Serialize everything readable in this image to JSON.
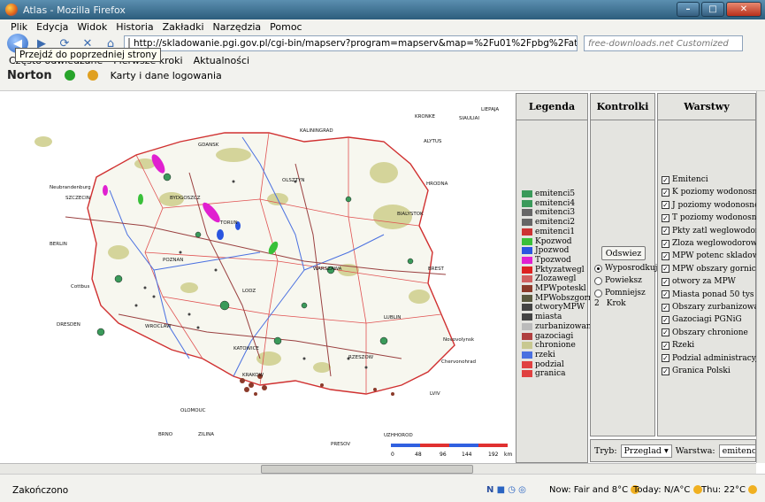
{
  "window": {
    "title": "Atlas - Mozilla Firefox"
  },
  "menu": [
    "Plik",
    "Edycja",
    "Widok",
    "Historia",
    "Zakładki",
    "Narzędzia",
    "Pomoc"
  ],
  "nav": {
    "url": "http://skladowanie.pgi.gov.pl/cgi-bin/mapserv?program=mapserv&map=%2Fu01%2Fpbg%2Fatlas.map",
    "search_placeholder": "free-downloads.net Customized",
    "tooltip": "Przejdź do poprzedniej strony"
  },
  "bookmarks": [
    "Często odwiedzane",
    "Pierwsze kroki",
    "Aktualności"
  ],
  "norton": {
    "label": "Norton",
    "cards": "Karty i dane logowania"
  },
  "panels": {
    "legend": "Legenda",
    "controls": "Kontrolki",
    "layers": "Warstwy"
  },
  "legend": [
    {
      "label": "emitenci5",
      "color": "#3a9a5a"
    },
    {
      "label": "emitenci4",
      "color": "#3a9a5a"
    },
    {
      "label": "emitenci3",
      "color": "#666666"
    },
    {
      "label": "emitenci2",
      "color": "#666666"
    },
    {
      "label": "emitenci1",
      "color": "#cc3333"
    },
    {
      "label": "Kpozwod",
      "color": "#39c039"
    },
    {
      "label": "Jpozwod",
      "color": "#2a55e0"
    },
    {
      "label": "Tpozwod",
      "color": "#e020d0"
    },
    {
      "label": "Pktyzatwegl",
      "color": "#dd2222"
    },
    {
      "label": "Zlozawegl",
      "color": "#d06060"
    },
    {
      "label": "MPWpoteskl",
      "color": "#8b3a2a"
    },
    {
      "label": "MPWobszgorn",
      "color": "#5a5a40"
    },
    {
      "label": "otworyMPW",
      "color": "#444444"
    },
    {
      "label": "miasta",
      "color": "#444444"
    },
    {
      "label": "zurbanizowane",
      "color": "#bbbbbb"
    },
    {
      "label": "gazociagi",
      "color": "#b04040"
    },
    {
      "label": "chronione",
      "color": "#c8c890"
    },
    {
      "label": "rzeki",
      "color": "#4a70e0"
    },
    {
      "label": "podzial",
      "color": "#e04040"
    },
    {
      "label": "granica",
      "color": "#e04040"
    }
  ],
  "controls": {
    "refresh": "Odswiez",
    "radios": [
      "Wyposrodkuj",
      "Powieksz",
      "Pomniejsz"
    ],
    "selected": 0,
    "step_value": "2",
    "step_label": "Krok"
  },
  "layers": [
    "Emitenci",
    "K poziomy wodonosne",
    "J poziomy wodonosne",
    "T poziomy wodonosne",
    "Pkty zatl weglowodorow",
    "Zloza weglowodorow",
    "MPW potenc skladow CO2",
    "MPW obszary gornicze",
    "otwory za MPW",
    "Miasta ponad 50 tys",
    "Obszary zurbanizowane",
    "Gazociagi PGNiG",
    "Obszary chronione",
    "Rzeki",
    "Podzial administracyjny",
    "Granica Polski"
  ],
  "tryb": {
    "label": "Tryb:",
    "value": "Przeglad",
    "warstwa_label": "Warstwa:",
    "warstwa_value": "emitenci"
  },
  "scale": {
    "ticks": [
      "0",
      "48",
      "96",
      "144",
      "192"
    ],
    "unit": "km"
  },
  "map_labels": [
    "KRONKE",
    "KALININGRAD",
    "LIEPAJA",
    "SIAULIAI",
    "ALYTUS",
    "OLSZTYN",
    "HRODNA",
    "BIALYSTOK",
    "GDANSK",
    "SZCZECIN",
    "Neubrandenburg",
    "BYDGOSZCZ",
    "TORUN",
    "BERLIN",
    "POZNAN",
    "WARSZAWA",
    "BREST",
    "LODZ",
    "Cottbus",
    "LUBLIN",
    "DRESDEN",
    "WROCLAW",
    "KATOWICE",
    "KRAKOW",
    "RZESZOW",
    "LVIV",
    "OLOMOUC",
    "BRNO",
    "ZILINA",
    "PRESOV",
    "Chervonohrad",
    "Novovolynsk",
    "UZHHOROD"
  ],
  "status": {
    "text": "Zakończono",
    "weather_now": "Now: Fair and 8°C",
    "weather_today": "Today: N/A°C",
    "weather_thu": "Thu: 22°C"
  }
}
